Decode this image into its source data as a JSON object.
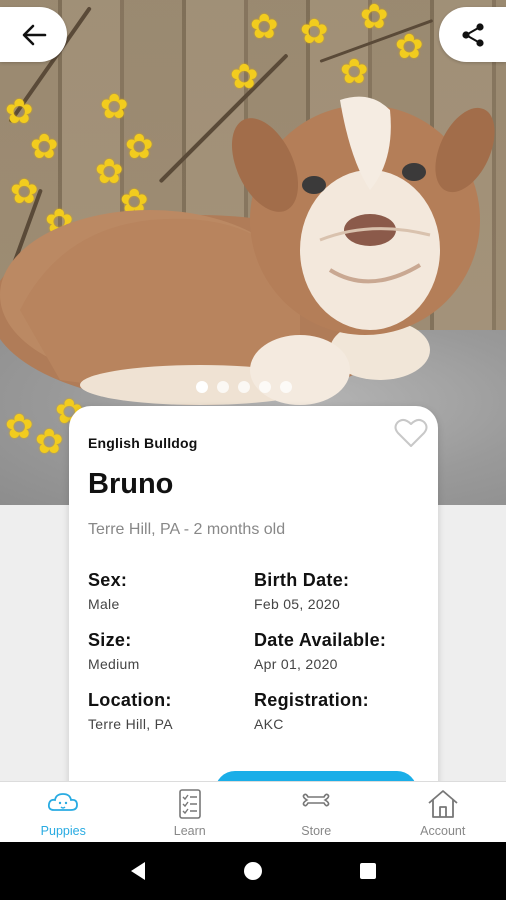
{
  "header": {
    "back_icon": "arrow-left-icon",
    "share_icon": "share-icon"
  },
  "carousel": {
    "total": 5,
    "active_index": 0
  },
  "listing": {
    "breed": "English Bulldog",
    "name": "Bruno",
    "location_age": "Terre Hill, PA - 2 months old",
    "favorite_icon": "heart-outline-icon",
    "attributes": [
      {
        "label": "Sex:",
        "value": "Male"
      },
      {
        "label": "Birth Date:",
        "value": "Feb 05, 2020"
      },
      {
        "label": "Size:",
        "value": "Medium"
      },
      {
        "label": "Date Available:",
        "value": "Apr 01, 2020"
      },
      {
        "label": "Location:",
        "value": "Terre Hill, PA"
      },
      {
        "label": "Registration:",
        "value": "AKC"
      }
    ],
    "cta_color": "#1aaee8"
  },
  "bottom_nav": {
    "active_color": "#29abe2",
    "items": [
      {
        "label": "Puppies",
        "icon": "puppy-cloud-icon"
      },
      {
        "label": "Learn",
        "icon": "checklist-icon"
      },
      {
        "label": "Store",
        "icon": "bone-icon"
      },
      {
        "label": "Account",
        "icon": "home-icon"
      }
    ]
  },
  "system_nav": {
    "back": "triangle-back-icon",
    "home": "circle-home-icon",
    "recents": "square-recents-icon"
  }
}
